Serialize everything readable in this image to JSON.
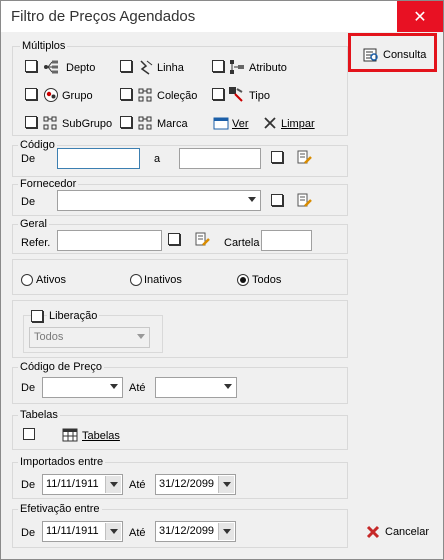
{
  "window": {
    "title": "Filtro de Preços Agendados",
    "close_symbol": "✕"
  },
  "multiplos": {
    "legend": "Múltiplos",
    "items": [
      {
        "label": "Depto"
      },
      {
        "label": "Linha"
      },
      {
        "label": "Atributo"
      },
      {
        "label": "Grupo"
      },
      {
        "label": "Coleção"
      },
      {
        "label": "Tipo"
      },
      {
        "label": "SubGrupo"
      },
      {
        "label": "Marca"
      },
      {
        "label": "Ver"
      },
      {
        "label": "Limpar"
      }
    ]
  },
  "codigo": {
    "legend": "Código",
    "from_label": "De",
    "to_label": "a",
    "from_value": "",
    "to_value": ""
  },
  "fornecedor": {
    "legend": "Fornecedor",
    "from_label": "De",
    "value": ""
  },
  "geral": {
    "legend": "Geral",
    "refer_label": "Refer.",
    "cartela_label": "Cartela",
    "refer_value": "",
    "cartela_value": ""
  },
  "status": {
    "options": [
      "Ativos",
      "Inativos",
      "Todos"
    ],
    "selected": "Todos"
  },
  "liberacao": {
    "label": "Liberação",
    "value": "Todos"
  },
  "codigo_preco": {
    "legend": "Código de Preço",
    "from_label": "De",
    "to_label": "Até"
  },
  "tabelas": {
    "legend": "Tabelas",
    "label": "Tabelas"
  },
  "importados": {
    "legend": "Importados entre",
    "from_label": "De",
    "to_label": "Até",
    "from_value": "11/11/1911",
    "to_value": "31/12/2099"
  },
  "efetivacao": {
    "legend": "Efetivação entre",
    "from_label": "De",
    "to_label": "Até",
    "from_value": "11/11/1911",
    "to_value": "31/12/2099"
  },
  "side": {
    "consulta_label": "Consulta",
    "cancelar_label": "Cancelar"
  },
  "colors": {
    "close_bg": "#e81123",
    "highlight_red": "#e3131b",
    "field_focus": "#3c7fb1"
  }
}
